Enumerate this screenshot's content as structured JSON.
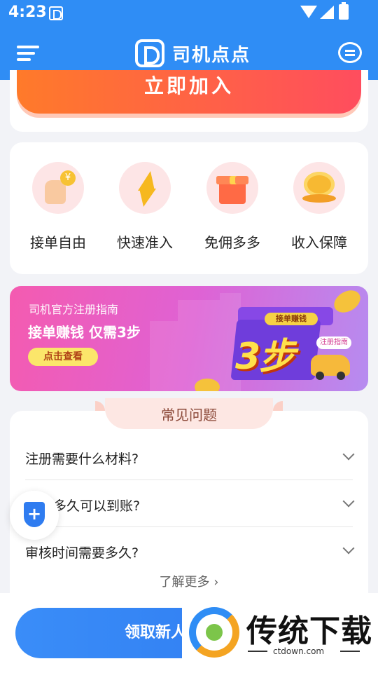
{
  "status_bar": {
    "time": "4:23",
    "app_icon": "app-notification-icon",
    "wifi": "wifi-icon",
    "signal": "signal-icon",
    "battery": "battery-charging-icon"
  },
  "navbar": {
    "title": "司机点点",
    "left_icon": "menu-icon",
    "logo_icon": "app-logo-icon",
    "right_icon": "message-icon"
  },
  "join_button": {
    "label": "立即加入"
  },
  "features": [
    {
      "label": "接单自由",
      "icon": "hand-coin-icon"
    },
    {
      "label": "快速准入",
      "icon": "lightning-icon"
    },
    {
      "label": "免佣多多",
      "icon": "gift-box-icon"
    },
    {
      "label": "收入保障",
      "icon": "coin-stack-icon"
    }
  ],
  "banner": {
    "subtitle": "司机官方注册指南",
    "headline": "接单赚钱 仅需3步",
    "cta": "点击查看",
    "graphic_tag": "接单赚钱",
    "graphic_big": "3步",
    "graphic_guide": "注册指南"
  },
  "faq": {
    "title": "常见问题",
    "items": [
      {
        "question": "注册需要什么材料?"
      },
      {
        "question": "多久可以到账?"
      },
      {
        "question": "审核时间需要多久?"
      }
    ],
    "more": "了解更多 ›"
  },
  "floating_button": {
    "icon": "shield-plus-icon"
  },
  "bottom_button": {
    "label": "领取新人"
  },
  "watermark": {
    "text": "传统下载",
    "url": "ctdown.com"
  },
  "colors": {
    "primary": "#2f8df5",
    "accent_orange": "#ff6a3c",
    "banner_pink": "#f45bb0",
    "text": "#222222"
  }
}
